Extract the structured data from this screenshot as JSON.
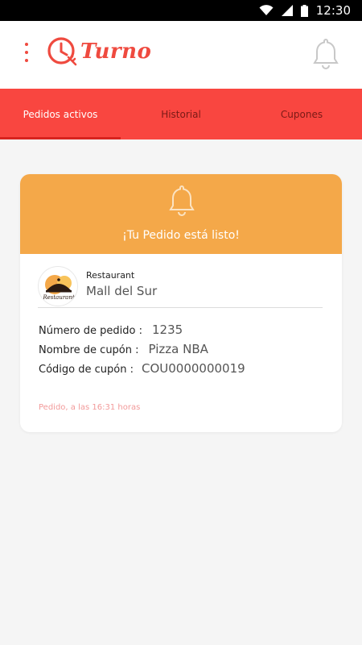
{
  "status_bar": {
    "time": "12:30",
    "icons": [
      "wifi-icon",
      "signal-icon",
      "battery-icon"
    ]
  },
  "header": {
    "logo_text": "Turno",
    "icons": [
      "menu-icon",
      "clock-fork-icon",
      "bell-icon"
    ]
  },
  "tabs": [
    {
      "label": "Pedidos activos",
      "active": true
    },
    {
      "label": "Historial",
      "active": false
    },
    {
      "label": "Cupones",
      "active": false
    }
  ],
  "order": {
    "banner_text": "¡Tu Pedido está listo!",
    "restaurant_label": "Restaurant",
    "restaurant_name": "Mall del Sur",
    "restaurant_logo_text": "Restaurant",
    "details": [
      {
        "label": "Número de pedido :",
        "value": "1235"
      },
      {
        "label": "Nombre de cupón :",
        "value": "Pizza NBA"
      },
      {
        "label": "Código de cupón :",
        "value": "COU0000000019"
      }
    ],
    "time_text": "Pedido, a las 16:31 horas"
  },
  "colors": {
    "brand_red": "#ef4a3f",
    "tab_bar": "#f94640",
    "banner_orange": "#f4a849",
    "time_pink": "#f29a9a"
  }
}
